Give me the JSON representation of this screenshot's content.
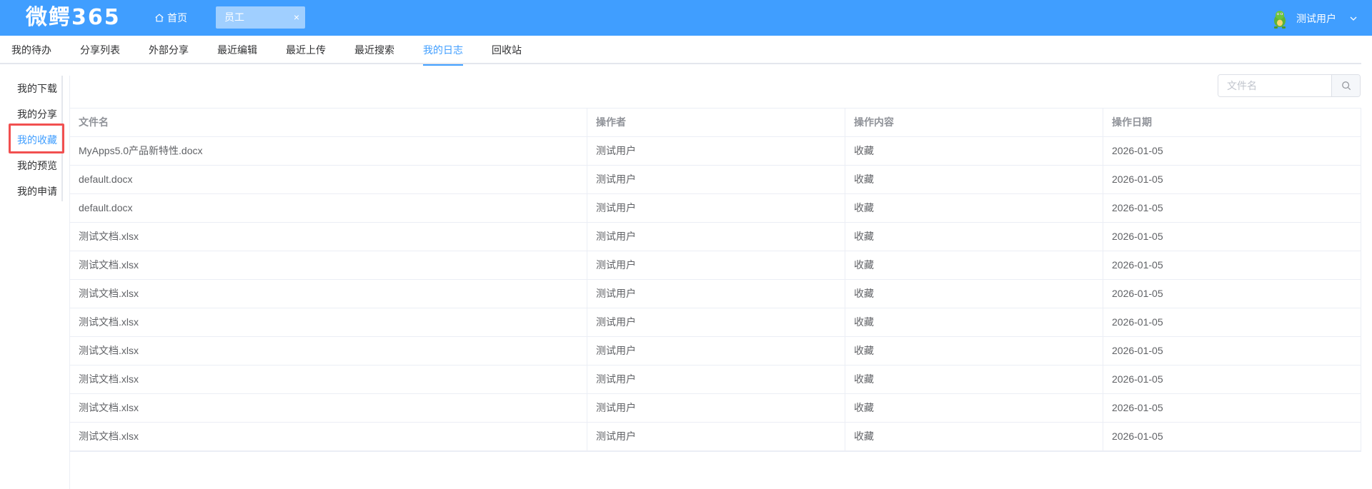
{
  "app": {
    "logo": "微鳄365"
  },
  "header": {
    "home_label": "首页",
    "open_tab": {
      "label": "员工",
      "close": "×"
    },
    "user_name": "测试用户"
  },
  "main_tabs": [
    {
      "label": "我的待办"
    },
    {
      "label": "分享列表"
    },
    {
      "label": "外部分享"
    },
    {
      "label": "最近编辑"
    },
    {
      "label": "最近上传"
    },
    {
      "label": "最近搜索"
    },
    {
      "label": "我的日志",
      "active": true
    },
    {
      "label": "回收站"
    }
  ],
  "side_tabs": [
    {
      "label": "我的下载"
    },
    {
      "label": "我的分享"
    },
    {
      "label": "我的收藏",
      "active": true
    },
    {
      "label": "我的预览"
    },
    {
      "label": "我的申请"
    }
  ],
  "search": {
    "placeholder": "文件名"
  },
  "table": {
    "columns": [
      "文件名",
      "操作者",
      "操作内容",
      "操作日期"
    ],
    "rows": [
      [
        "MyApps5.0产品新特性.docx",
        "测试用户",
        "收藏",
        "2026-01-05"
      ],
      [
        "default.docx",
        "测试用户",
        "收藏",
        "2026-01-05"
      ],
      [
        "default.docx",
        "测试用户",
        "收藏",
        "2026-01-05"
      ],
      [
        "测试文档.xlsx",
        "测试用户",
        "收藏",
        "2026-01-05"
      ],
      [
        "测试文档.xlsx",
        "测试用户",
        "收藏",
        "2026-01-05"
      ],
      [
        "测试文档.xlsx",
        "测试用户",
        "收藏",
        "2026-01-05"
      ],
      [
        "测试文档.xlsx",
        "测试用户",
        "收藏",
        "2026-01-05"
      ],
      [
        "测试文档.xlsx",
        "测试用户",
        "收藏",
        "2026-01-05"
      ],
      [
        "测试文档.xlsx",
        "测试用户",
        "收藏",
        "2026-01-05"
      ],
      [
        "测试文档.xlsx",
        "测试用户",
        "收藏",
        "2026-01-05"
      ],
      [
        "测试文档.xlsx",
        "测试用户",
        "收藏",
        "2026-01-05"
      ]
    ]
  },
  "colors": {
    "brand": "#409eff",
    "highlight": "#f15050"
  },
  "icons": {
    "home": "home-icon",
    "close": "close-icon",
    "avatar": "crocodile-avatar-icon",
    "chevron": "chevron-down-icon",
    "search": "search-icon"
  }
}
